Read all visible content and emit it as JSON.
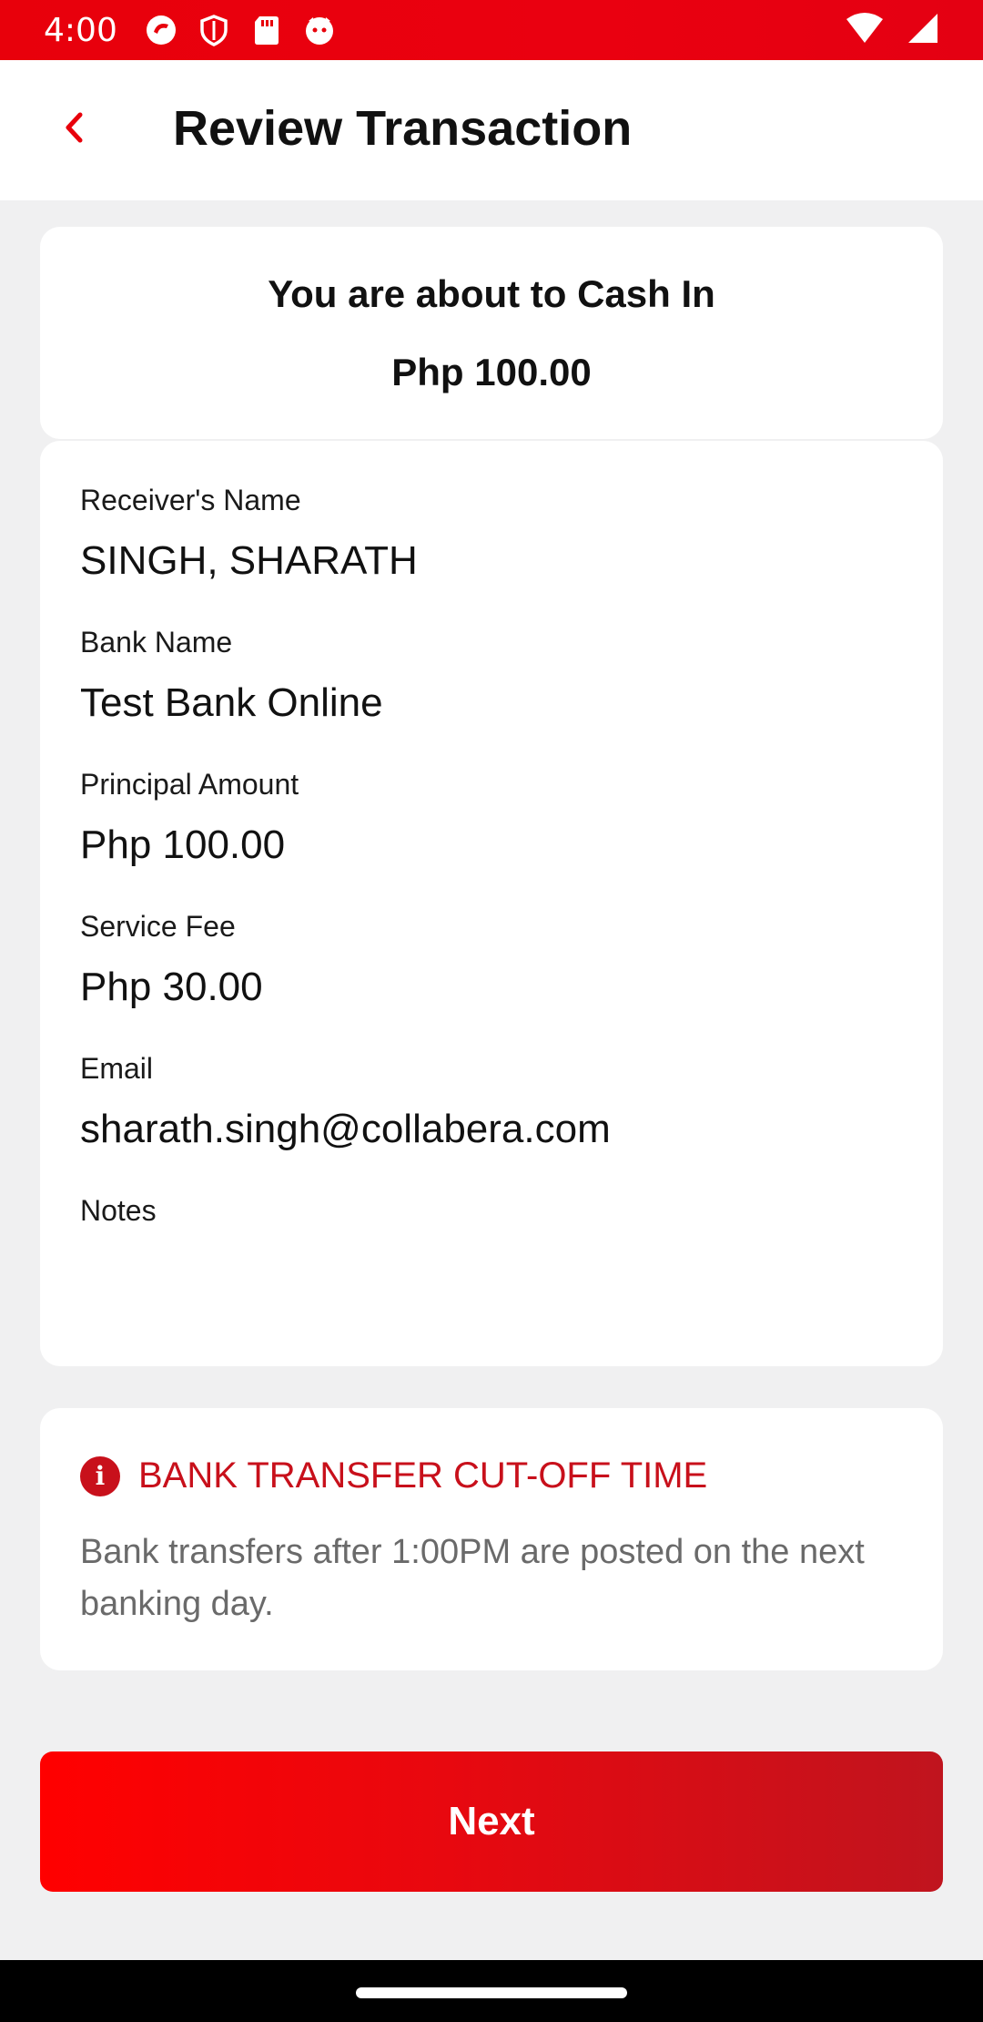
{
  "status_bar": {
    "time": "4:00",
    "left_icons": [
      "sync-icon",
      "shield-icon",
      "sd-card-icon",
      "cat-icon"
    ],
    "right_icons": [
      "wifi-icon",
      "signal-icon"
    ]
  },
  "header": {
    "back_icon": "chevron-left-icon",
    "title": "Review Transaction"
  },
  "summary": {
    "line1": "You are about to Cash In",
    "amount": "Php 100.00"
  },
  "details": {
    "receiver_label": "Receiver's Name",
    "receiver_value": "SINGH, SHARATH",
    "bank_label": "Bank Name",
    "bank_value": "Test Bank Online",
    "principal_label": "Principal Amount",
    "principal_value": "Php 100.00",
    "fee_label": "Service Fee",
    "fee_value": "Php 30.00",
    "email_label": "Email",
    "email_value": "sharath.singh@collabera.com",
    "notes_label": "Notes",
    "notes_value": ""
  },
  "notice": {
    "icon": "info-icon",
    "title": "BANK TRANSFER CUT-OFF TIME",
    "body": "Bank transfers after 1:00PM are posted on the next banking day."
  },
  "actions": {
    "next_label": "Next"
  },
  "colors": {
    "brand_red": "#e8000b",
    "notice_red": "#c8101b"
  }
}
